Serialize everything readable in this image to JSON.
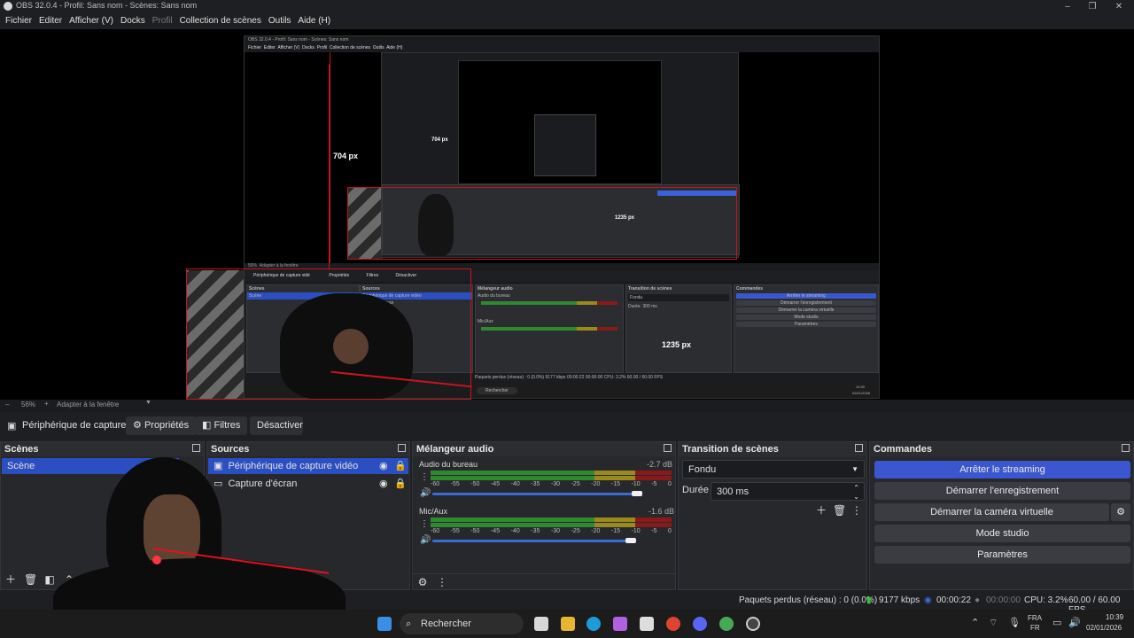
{
  "window": {
    "title": "OBS 32.0.4 - Profil: Sans nom - Scènes: Sans nom",
    "controls": [
      "–",
      "❐",
      "✕"
    ]
  },
  "menu": [
    {
      "label": "Fichier",
      "dim": false
    },
    {
      "label": "Editer",
      "dim": false
    },
    {
      "label": "Afficher (V)",
      "dim": false
    },
    {
      "label": "Docks",
      "dim": false
    },
    {
      "label": "Profil",
      "dim": true
    },
    {
      "label": "Collection de scènes",
      "dim": false
    },
    {
      "label": "Outils",
      "dim": false
    },
    {
      "label": "Aide (H)",
      "dim": false
    }
  ],
  "preview": {
    "dim_vertical": "704 px",
    "dim_horizontal": "1235 px",
    "nested": {
      "title": "OBS 32.0.4 - Profil: Sans nom - Scènes: Sans nom",
      "menu": "Fichier  Editer  Afficher (V)  Docks  Profil  Collection de scènes  Outils  Aide (H)",
      "zoom": "56%",
      "fit": "Adapter à la fenêtre",
      "source": "Périphérique de capture vidé",
      "props": "Propriétés",
      "filters": "Filtres",
      "deactivate": "Désactiver",
      "scenes_title": "Scènes",
      "scene_item": "Scène",
      "sources_title": "Sources",
      "source1": "Périphérique de capture vidéo",
      "source2": "Capture d'écran",
      "mixer_title": "Mélangeur audio",
      "mixer_ch1": "Audio du bureau",
      "mixer_ch2": "Mic/Aux",
      "trans_title": "Transition de scènes",
      "trans_value": "Fondu",
      "duration": "Durée",
      "duration_value": "300 ms",
      "cmd_title": "Commandes",
      "cmds": [
        "Arrêter le streaming",
        "Démarrer l'enregistrement",
        "Démarrer la caméra virtuelle",
        "Mode studio",
        "Paramètres"
      ],
      "status": "Paquets perdus (réseau) : 0 (0.0%)   9177 kbps   00:00:22   00:00:00   CPU: 3.2%   60.00 / 60.00 FPS",
      "search": "Rechercher",
      "time": "10:39",
      "date": "02/01/2026"
    }
  },
  "zoom": {
    "minus": "–",
    "value": "56%",
    "plus": "+",
    "fit_label": "Adapter à la fenêtre"
  },
  "source_toolbar": {
    "source_name": "Périphérique de capture vi",
    "properties": "Propriétés",
    "filters": "Filtres",
    "deactivate": "Désactiver"
  },
  "scenes": {
    "title": "Scènes",
    "items": [
      {
        "label": "Scène",
        "selected": true
      }
    ]
  },
  "sources": {
    "title": "Sources",
    "items": [
      {
        "label": "Périphérique de capture vidéo",
        "selected": true,
        "icon": "camera-icon"
      },
      {
        "label": "Capture d'écran",
        "selected": false,
        "icon": "monitor-icon"
      }
    ]
  },
  "mixer": {
    "title": "Mélangeur audio",
    "ticks": [
      "-60",
      "-55",
      "-50",
      "-45",
      "-40",
      "-35",
      "-30",
      "-25",
      "-20",
      "-15",
      "-10",
      "-5",
      "0"
    ],
    "channels": [
      {
        "name": "Audio du bureau",
        "db": "-2.7 dB",
        "volume": 0.95
      },
      {
        "name": "Mic/Aux",
        "db": "-1.6 dB",
        "volume": 0.92
      }
    ]
  },
  "transition": {
    "title": "Transition de scènes",
    "type": "Fondu",
    "duration_label": "Durée",
    "duration_value": "300 ms"
  },
  "commands": {
    "title": "Commandes",
    "buttons": [
      "Arrêter le streaming",
      "Démarrer l'enregistrement",
      "Démarrer la caméra virtuelle",
      "Mode studio",
      "Paramètres"
    ]
  },
  "status": {
    "dropped": "Paquets perdus (réseau) : 0 (0.0%)",
    "bitrate": "9177 kbps",
    "stream_time": "00:00:22",
    "rec_time": "00:00:00",
    "cpu": "CPU: 3.2%",
    "fps": "60.00 / 60.00 FPS"
  },
  "taskbar": {
    "search": "Rechercher",
    "lang_top": "FRA",
    "lang_bottom": "FR",
    "time": "10:39",
    "date": "02/01/2026"
  },
  "colors": {
    "accent": "#3b57d0",
    "selected": "#2b4fc2",
    "red": "#c8141e",
    "meter_green": "#2f8a2f",
    "meter_yellow": "#9a8a1a",
    "meter_red": "#8a1a1a"
  }
}
